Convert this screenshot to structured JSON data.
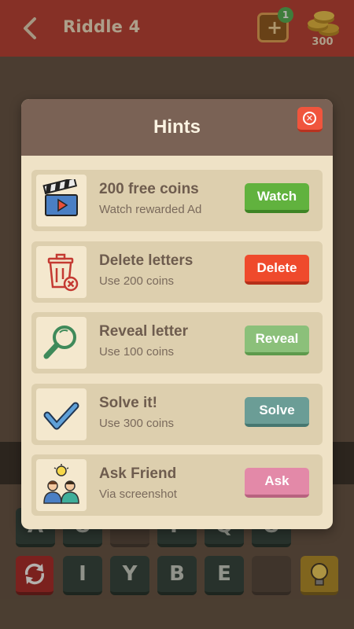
{
  "header": {
    "title": "Riddle 4",
    "hint_badge_count": "1",
    "coins": "300"
  },
  "board": {
    "row1": [
      "A",
      "O",
      "",
      "F",
      "Q",
      "O"
    ],
    "row2": [
      "I",
      "Y",
      "B",
      "E",
      ""
    ]
  },
  "modal": {
    "title": "Hints",
    "hints": [
      {
        "name": "200 free coins",
        "subtitle": "Watch rewarded Ad",
        "button": "Watch",
        "icon": "clapperboard-icon",
        "color": "#61b23e"
      },
      {
        "name": "Delete letters",
        "subtitle": "Use 200 coins",
        "button": "Delete",
        "icon": "trash-icon",
        "color": "#ef4a2c"
      },
      {
        "name": "Reveal letter",
        "subtitle": "Use 100 coins",
        "button": "Reveal",
        "icon": "magnifier-icon",
        "color": "#8bc07a"
      },
      {
        "name": "Solve it!",
        "subtitle": "Use 300 coins",
        "button": "Solve",
        "icon": "checkmark-icon",
        "color": "#6b9d96"
      },
      {
        "name": "Ask Friend",
        "subtitle": "Via screenshot",
        "button": "Ask",
        "icon": "friends-icon",
        "color": "#e389a8"
      }
    ]
  }
}
